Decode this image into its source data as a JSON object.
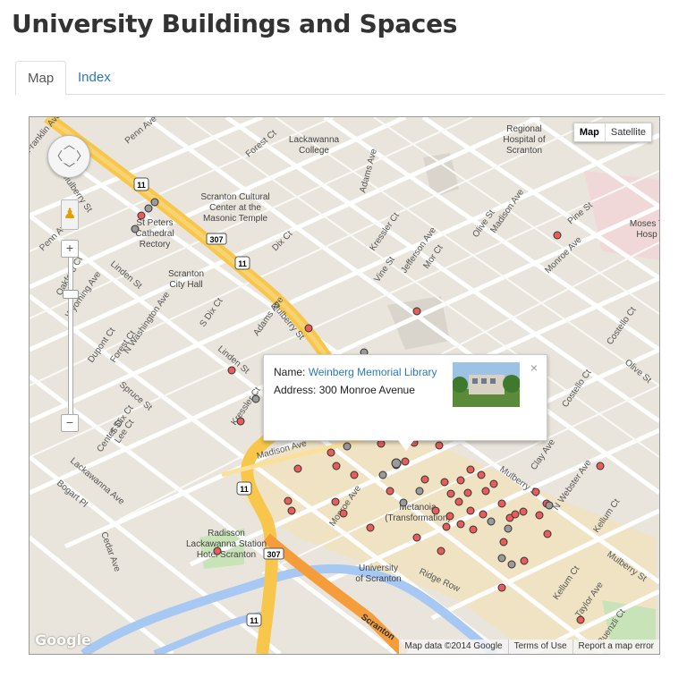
{
  "page": {
    "title": "University Buildings and Spaces"
  },
  "tabs": [
    {
      "label": "Map",
      "active": true
    },
    {
      "label": "Index",
      "active": false
    }
  ],
  "map": {
    "type_buttons": {
      "map": "Map",
      "satellite": "Satellite"
    },
    "zoom_in": "+",
    "zoom_out": "−",
    "attribution": {
      "data": "Map data ©2014 Google",
      "terms": "Terms of Use",
      "report": "Report a map error"
    },
    "google_logo": "Google",
    "popup": {
      "name_label": "Name:",
      "name_value": "Weinberg Memorial Library",
      "address_label": "Address:",
      "address_value": "300 Monroe Avenue",
      "close": "×"
    },
    "place_labels": {
      "regional_hospital": [
        "Regional",
        "Hospital of",
        "Scranton"
      ],
      "lackawanna_college": [
        "Lackawanna",
        "College"
      ],
      "scranton_cultural": [
        "Scranton Cultural",
        "Center at the",
        "Masonic Temple"
      ],
      "st_peters": [
        "St Peters",
        "Cathedral",
        "Rectory"
      ],
      "scranton_city_hall": [
        "Scranton",
        "City Hall"
      ],
      "moses_taylor": [
        "Moses T",
        "Hosp"
      ],
      "metanoia": [
        "Metanoia",
        "(Transformation)"
      ],
      "radisson": [
        "Radisson",
        "Lackawanna Station",
        "Hotel Scranton"
      ],
      "university": [
        "University",
        "of Scranton"
      ]
    },
    "street_labels": [
      "Mulberry St",
      "Penn Ave",
      "Wyoming Ave",
      "Forest Ct",
      "Adams Ave",
      "Kressler Ct",
      "Jefferson Ave",
      "Vine St",
      "Mor Ct",
      "Olive St",
      "Madison Ave",
      "Pine St",
      "Monroe Ave",
      "Dix Ct",
      "Linden St",
      "Oakford Ct",
      "N Washington Ave",
      "S Dix Ct",
      "Dupont Ct",
      "Spruce St",
      "Lee Ct",
      "Center St",
      "Lackawanna Ave",
      "Bogart Pl",
      "Cedar Ave",
      "Ridge Row",
      "Clay Ave",
      "N Webster Ave",
      "Kellum Ct",
      "Taylor Ave",
      "Buenzli Ct",
      "Costello Ct",
      "Olive St",
      "Scranton",
      "Franklin Ave"
    ],
    "route_shields": [
      "11",
      "307",
      "11",
      "11",
      "307",
      "11"
    ],
    "colors": {
      "marker_red": "#e85c5c",
      "marker_gray": "#9a9a9a",
      "highway": "#f7c64a",
      "river": "#a7c8f2",
      "campus": "#efe3c3"
    }
  }
}
